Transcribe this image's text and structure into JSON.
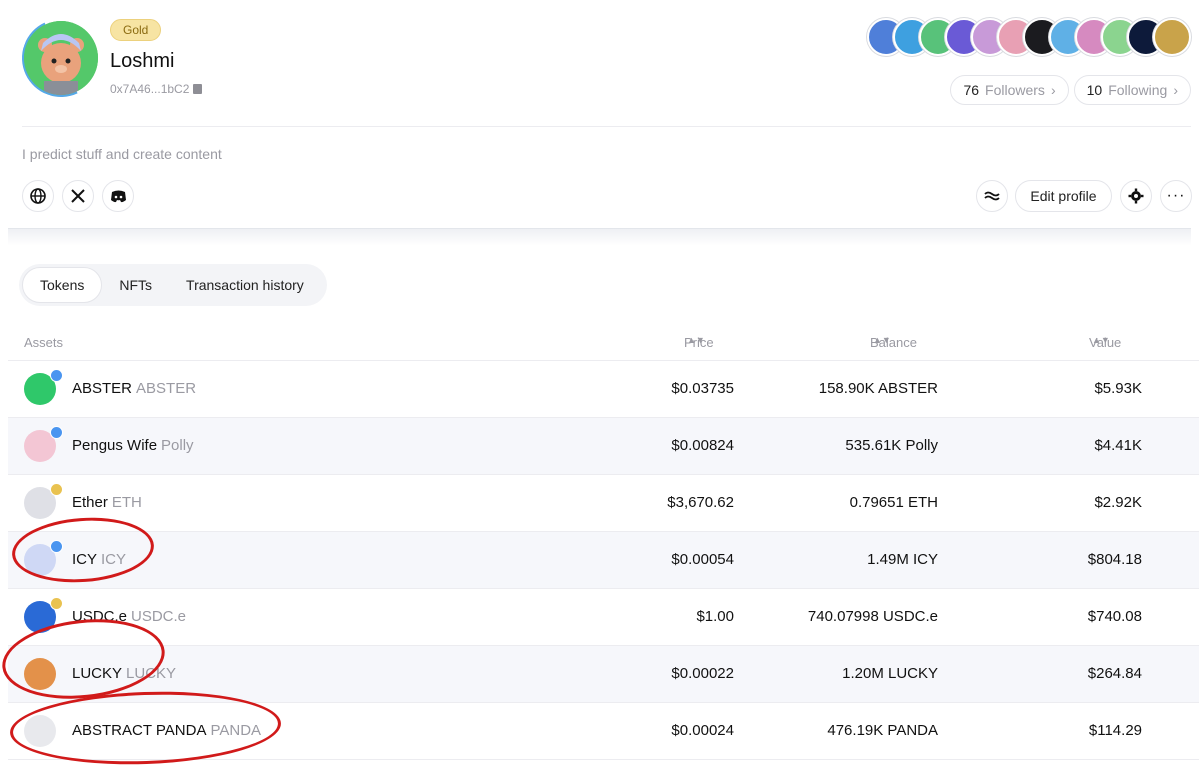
{
  "profile": {
    "tier": "Gold",
    "username": "Loshmi",
    "address": "0x7A46...1bC2",
    "bio": "I predict stuff and create content",
    "followers_count": "76",
    "followers_label": "Followers",
    "following_count": "10",
    "following_label": "Following"
  },
  "badge_colors": [
    "#4f7fd9",
    "#3ea0e0",
    "#58c27a",
    "#6a5ad6",
    "#c89ad8",
    "#e8a0b4",
    "#1b1b1f",
    "#5fb0e6",
    "#d68ac0",
    "#8bd48f",
    "#0d1a3a",
    "#c9a34a"
  ],
  "actions": {
    "edit_profile": "Edit profile"
  },
  "tabs": [
    {
      "label": "Tokens"
    },
    {
      "label": "NFTs"
    },
    {
      "label": "Transaction history"
    }
  ],
  "table": {
    "headers": {
      "assets": "Assets",
      "price": "Price",
      "balance": "Balance",
      "value": "Value"
    },
    "rows": [
      {
        "name": "ABSTER",
        "symbol": "ABSTER",
        "price": "$0.03735",
        "balance": "158.90K ABSTER",
        "value": "$5.93K",
        "icon_color": "#2fc86a",
        "verify": "blue"
      },
      {
        "name": "Pengus Wife",
        "symbol": "Polly",
        "price": "$0.00824",
        "balance": "535.61K Polly",
        "value": "$4.41K",
        "icon_color": "#f3c6d4",
        "verify": "blue"
      },
      {
        "name": "Ether",
        "symbol": "ETH",
        "price": "$3,670.62",
        "balance": "0.79651 ETH",
        "value": "$2.92K",
        "icon_color": "#dfe0e6",
        "verify": "gold"
      },
      {
        "name": "ICY",
        "symbol": "ICY",
        "price": "$0.00054",
        "balance": "1.49M ICY",
        "value": "$804.18",
        "icon_color": "#cfd8f5",
        "verify": "blue"
      },
      {
        "name": "USDC.e",
        "symbol": "USDC.e",
        "price": "$1.00",
        "balance": "740.07998 USDC.e",
        "value": "$740.08",
        "icon_color": "#2a6ad6",
        "verify": "gold"
      },
      {
        "name": "LUCKY",
        "symbol": "LUCKY",
        "price": "$0.00022",
        "balance": "1.20M LUCKY",
        "value": "$264.84",
        "icon_color": "#e3914a",
        "verify": "none"
      },
      {
        "name": "ABSTRACT PANDA",
        "symbol": "PANDA",
        "price": "$0.00024",
        "balance": "476.19K PANDA",
        "value": "$114.29",
        "icon_color": "#e8e9ed",
        "verify": "none"
      }
    ]
  },
  "colors": {
    "annotation": "#d11a1a",
    "verify_blue": "#4a95f0",
    "verify_gold": "#e9c250"
  }
}
